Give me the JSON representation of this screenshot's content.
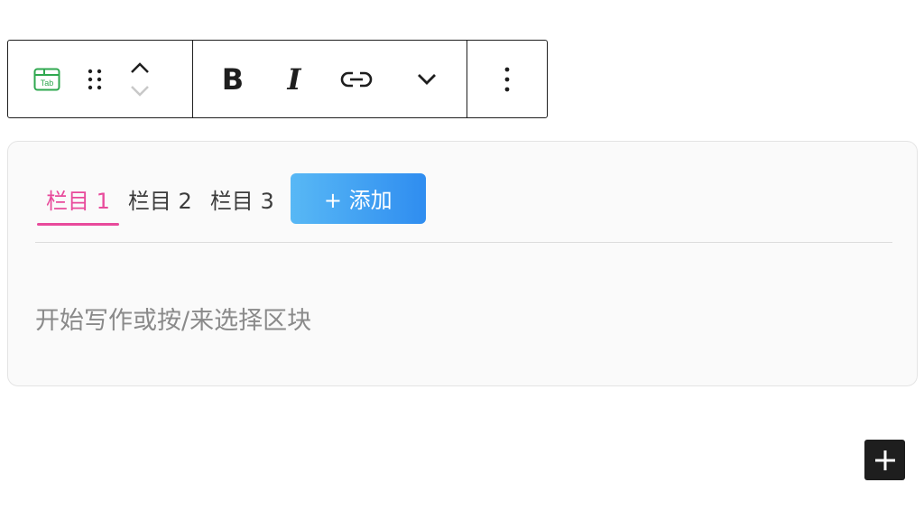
{
  "toolbar": {
    "block_type_icon": "tab-block-icon",
    "block_icon_text": "Tab",
    "drag_icon": "drag-handle-icon",
    "move_up_icon": "chevron-up-icon",
    "move_down_icon": "chevron-down-icon",
    "bold_label": "B",
    "italic_label": "I",
    "link_icon": "link-icon",
    "more_formatting_icon": "chevron-down-icon",
    "options_icon": "more-vertical-icon"
  },
  "tabs_block": {
    "tabs": [
      {
        "label": "栏目 1",
        "active": true
      },
      {
        "label": "栏目 2",
        "active": false
      },
      {
        "label": "栏目 3",
        "active": false
      }
    ],
    "add_button_label": "+ 添加",
    "placeholder": "开始写作或按/来选择区块"
  },
  "inserter": {
    "icon": "plus-icon"
  },
  "colors": {
    "active_tab": "#e84a9b",
    "add_button_start": "#58b8f5",
    "add_button_end": "#2f8df0",
    "block_icon": "#2fa84f"
  }
}
